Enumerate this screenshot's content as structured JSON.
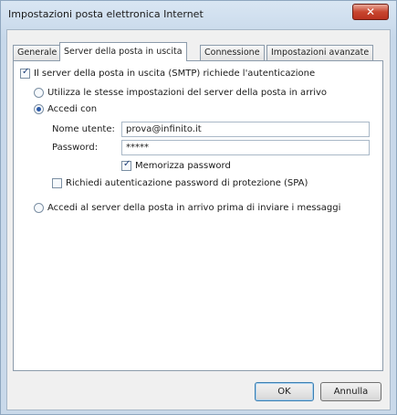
{
  "window": {
    "title": "Impostazioni posta elettronica Internet",
    "close_glyph": "✕"
  },
  "tabs": [
    {
      "label": "Generale",
      "active": false
    },
    {
      "label": "Server della posta in uscita",
      "active": true
    },
    {
      "label": "Connessione",
      "active": false
    },
    {
      "label": "Impostazioni avanzate",
      "active": false
    }
  ],
  "outgoing": {
    "smtp_auth_label": "Il server della posta in uscita (SMTP) richiede l'autenticazione",
    "smtp_auth_checked": true,
    "use_same_label": "Utilizza le stesse impostazioni del server della posta in arrivo",
    "login_with_label": "Accedi con",
    "username_label": "Nome utente:",
    "username_value": "prova@infinito.it",
    "password_label": "Password:",
    "password_value": "*****",
    "remember_label": "Memorizza password",
    "remember_checked": true,
    "spa_label": "Richiedi autenticazione password di protezione (SPA)",
    "spa_checked": false,
    "login_before_label": "Accedi al server della posta in arrivo prima di inviare i messaggi"
  },
  "buttons": {
    "ok": "OK",
    "cancel": "Annulla"
  }
}
